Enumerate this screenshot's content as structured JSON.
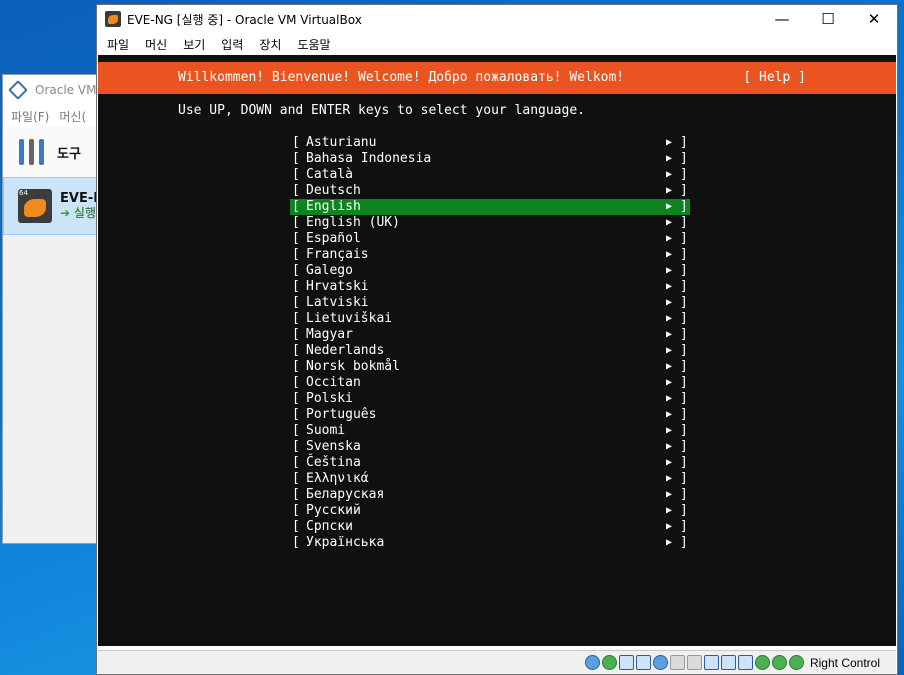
{
  "background_window": {
    "title": "Oracle VM V",
    "menu": [
      "파일(F)",
      "머신("
    ],
    "tools_label": "도구",
    "vm_name": "EVE-N",
    "vm_state": "실행",
    "vm_badge": "64"
  },
  "window": {
    "title": "EVE-NG [실행 중] - Oracle VM VirtualBox",
    "controls": {
      "minimize": "—",
      "maximize": "☐",
      "close": "✕"
    },
    "menu": [
      "파일",
      "머신",
      "보기",
      "입력",
      "장치",
      "도움말"
    ]
  },
  "console": {
    "banner_text": "Willkommen! Bienvenue! Welcome! Добро пожаловать! Welkom!",
    "help_label": "[ Help ]",
    "instruction": "Use UP, DOWN and ENTER keys to select your language.",
    "selected_index": 4,
    "languages": [
      "Asturianu",
      "Bahasa Indonesia",
      "Català",
      "Deutsch",
      "English",
      "English (UK)",
      "Español",
      "Français",
      "Galego",
      "Hrvatski",
      "Latviski",
      "Lietuviškai",
      "Magyar",
      "Nederlands",
      "Norsk bokmål",
      "Occitan",
      "Polski",
      "Português",
      "Suomi",
      "Svenska",
      "Čeština",
      "Ελληνικά",
      "Беларуская",
      "Русский",
      "Српски",
      "Українська"
    ],
    "item_left_bracket": "[",
    "item_right_bracket": "]",
    "item_arrow": "▶"
  },
  "statusbar": {
    "host_key_label": "Right Control"
  },
  "colors": {
    "banner": "#e95420",
    "selection": "#0e8420",
    "console_bg": "#101010"
  }
}
